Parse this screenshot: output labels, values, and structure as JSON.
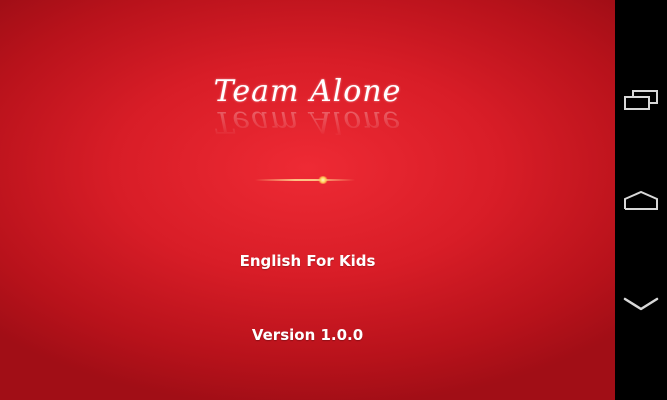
{
  "splash": {
    "logo_text": "Team Alone",
    "app_name": "English For Kids",
    "version": "Version 1.0.0"
  },
  "navbar": {
    "buttons": [
      {
        "name": "recent-apps",
        "icon": "recent-apps-icon"
      },
      {
        "name": "home",
        "icon": "home-icon"
      },
      {
        "name": "back",
        "icon": "back-icon"
      }
    ]
  },
  "colors": {
    "background": "#d81d27",
    "text": "#ffffff",
    "navbar": "#000000"
  }
}
